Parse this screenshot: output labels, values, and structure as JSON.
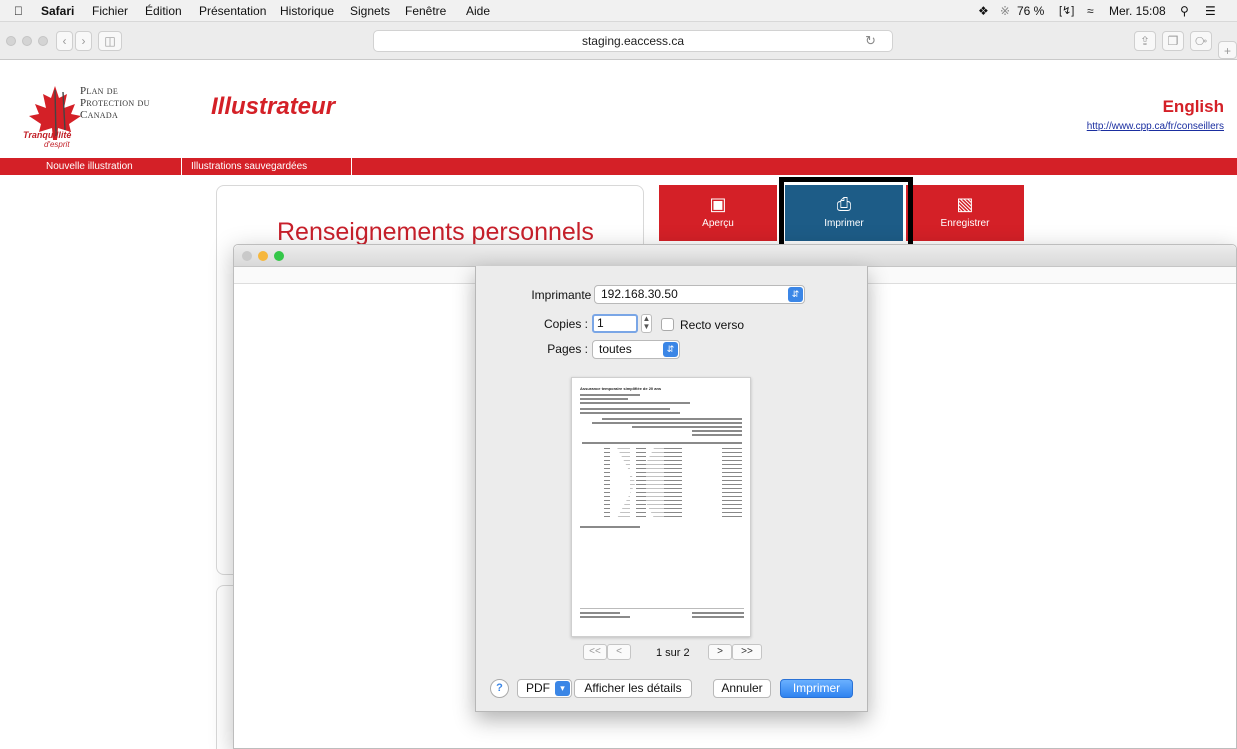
{
  "menubar": {
    "app": "Safari",
    "items": [
      "Fichier",
      "Édition",
      "Présentation",
      "Historique",
      "Signets",
      "Fenêtre",
      "Aide"
    ],
    "battery": "76 %",
    "clock": "Mer. 15:08"
  },
  "browser": {
    "url": "staging.eaccess.ca"
  },
  "site": {
    "logo_line1": "Plan de",
    "logo_line2": "Protection du",
    "logo_line3": "Canada",
    "logo_tag1": "Tranquillité",
    "logo_tag2": "d'esprit",
    "app_title": "Illustrateur",
    "lang_link": "English",
    "advisor_link": "http://www.cpp.ca/fr/conseillers",
    "nav": [
      "Nouvelle illustration",
      "Illustrations sauvegardées"
    ],
    "card_title": "Renseignements personnels",
    "actions": {
      "preview": "Aperçu",
      "print": "Imprimer",
      "save": "Enregistrer"
    }
  },
  "print_dialog": {
    "printer_label": "Imprimante :",
    "printer_value": "192.168.30.50",
    "copies_label": "Copies :",
    "copies_value": "1",
    "duplex_label": "Recto verso",
    "pages_label": "Pages :",
    "pages_value": "toutes",
    "preview_doc_title": "Assurance temporaire simplifiée de 20 ans",
    "page_indicator": "1 sur 2",
    "pager": {
      "first": "<<",
      "prev": "<",
      "next": ">",
      "last": ">>"
    },
    "help": "?",
    "pdf": "PDF",
    "details": "Afficher les détails",
    "cancel": "Annuler",
    "print": "Imprimer"
  },
  "colors": {
    "brand_red": "#d42027",
    "button_blue": "#1d5c87",
    "mac_blue": "#3b86e6"
  }
}
